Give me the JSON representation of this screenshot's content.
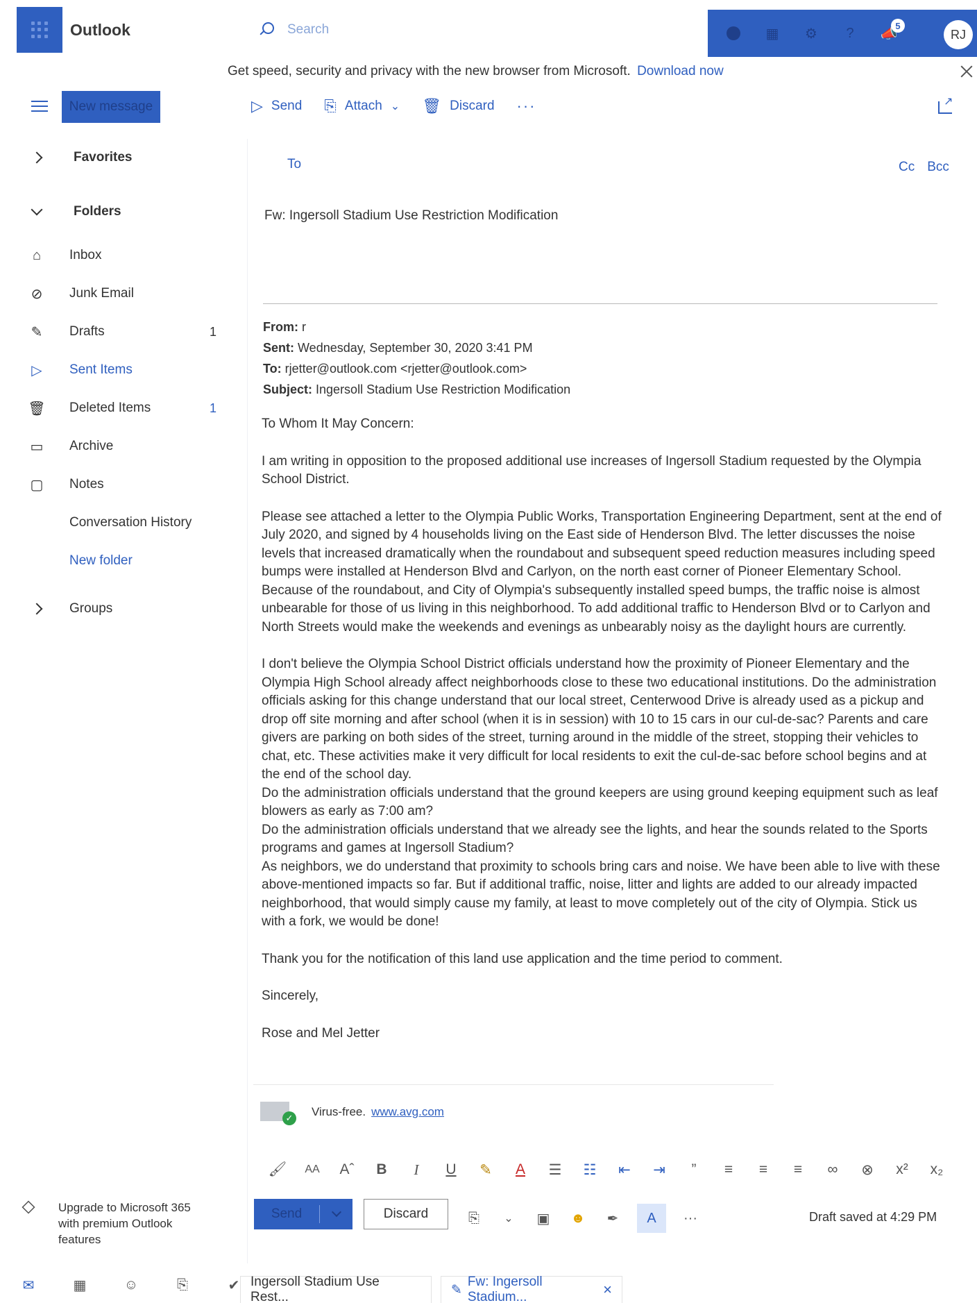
{
  "app": {
    "title": "Outlook"
  },
  "search": {
    "placeholder": "Search"
  },
  "header": {
    "avatar_initials": "RJ",
    "notification_count": "5"
  },
  "promo": {
    "text": "Get speed, security and privacy with the new browser from Microsoft.",
    "link": "Download now"
  },
  "nav": {
    "new_message": "New message",
    "favorites": "Favorites",
    "folders": "Folders",
    "items": [
      {
        "label": "Inbox",
        "count": ""
      },
      {
        "label": "Junk Email",
        "count": ""
      },
      {
        "label": "Drafts",
        "count": "1"
      },
      {
        "label": "Sent Items",
        "count": ""
      },
      {
        "label": "Deleted Items",
        "count": "1"
      },
      {
        "label": "Archive",
        "count": ""
      },
      {
        "label": "Notes",
        "count": ""
      },
      {
        "label": "Conversation History",
        "count": ""
      }
    ],
    "new_folder": "New folder",
    "groups": "Groups",
    "upgrade_text": "Upgrade to Microsoft 365 with premium Outlook features"
  },
  "compose_toolbar": {
    "send": "Send",
    "attach": "Attach",
    "discard": "Discard"
  },
  "compose": {
    "to_label": "To",
    "cc": "Cc",
    "bcc": "Bcc",
    "subject": "Fw: Ingersoll Stadium Use Restriction Modification"
  },
  "forwarded": {
    "from_label": "From:",
    "from": "r",
    "sent_label": "Sent:",
    "sent": "Wednesday, September 30, 2020 3:41 PM",
    "to_label": "To:",
    "to": "rjetter@outlook.com <rjetter@outlook.com>",
    "subject_label": "Subject:",
    "subject": "Ingersoll Stadium Use Restriction Modification"
  },
  "body": {
    "greeting": "To Whom It May Concern:",
    "p1": "I am writing in opposition to the proposed additional use increases of Ingersoll Stadium requested by the Olympia School District.",
    "p2": "Please see attached a letter to the Olympia Public Works, Transportation Engineering Department, sent at the end of July 2020, and signed by 4 households living on the East side of Henderson Blvd. The letter discusses the noise levels that increased dramatically when the roundabout and subsequent speed reduction measures including speed bumps were installed at Henderson Blvd and Carlyon, on the north east corner of Pioneer Elementary School. Because of the roundabout, and City of Olympia's subsequently installed speed bumps, the traffic noise is almost unbearable for those of us living in this neighborhood. To add additional traffic to Henderson Blvd or to Carlyon and North Streets would make the weekends and evenings as unbearably noisy as the daylight hours are currently.",
    "p3": "I don't believe the Olympia School District officials understand how the proximity of Pioneer Elementary and the Olympia High School already affect neighborhoods close to these two educational institutions. Do the administration officials asking for this change understand that our local street, Centerwood Drive is already used as a pickup and drop off site morning and after school (when it is in session) with 10 to 15 cars in our cul-de-sac? Parents and care givers are parking on both sides of the street, turning around in the middle of the street, stopping their vehicles to chat, etc. These activities make it very difficult for local residents to exit the cul-de-sac before school begins and at the end of the school day.",
    "p4": "Do the administration officials understand that the ground keepers are using ground keeping equipment such as leaf blowers as early as 7:00 am?",
    "p5": "Do the administration officials understand that we already see the lights, and hear the sounds related to the Sports programs and games at Ingersoll Stadium?",
    "p6": "As neighbors, we do understand that proximity to schools bring cars and noise. We have been able to live with these above-mentioned impacts so far. But if additional traffic, noise, litter and lights are added to our already impacted neighborhood, that would simply cause my family, at least to move completely out of the city of Olympia. Stick us with a fork, we would be done!",
    "p7": "Thank you for the notification of this land use application and the time period to comment.",
    "closing": "Sincerely,",
    "signature": "Rose and Mel Jetter"
  },
  "avg": {
    "text": "Virus-free.",
    "link": "www.avg.com"
  },
  "actions": {
    "send": "Send",
    "discard": "Discard",
    "draft_status": "Draft saved at 4:29 PM"
  },
  "tabs": [
    {
      "label": "Ingersoll Stadium Use Rest..."
    },
    {
      "label": "Fw: Ingersoll Stadium..."
    }
  ],
  "colors": {
    "accent": "#2f5fbf",
    "accent_dark": "#1f3f8a",
    "text": "#333333"
  },
  "icons": {
    "nav": [
      "inbox-icon",
      "junk-icon",
      "drafts-icon",
      "sent-icon",
      "deleted-icon",
      "archive-icon",
      "notes-icon"
    ],
    "bottom_nav": [
      "mail-icon",
      "calendar-icon",
      "people-icon",
      "files-icon",
      "todo-icon"
    ]
  }
}
